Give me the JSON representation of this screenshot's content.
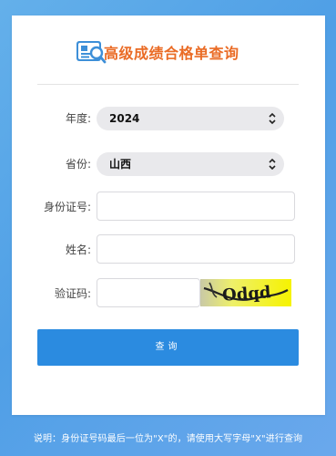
{
  "header": {
    "title": "高级成绩合格单查询",
    "logo_icon": "document-search-icon",
    "title_color": "#ea6b25"
  },
  "form": {
    "year": {
      "label": "年度:",
      "value": "2024"
    },
    "province": {
      "label": "省份:",
      "value": "山西"
    },
    "id_number": {
      "label": "身份证号:",
      "value": "",
      "placeholder": ""
    },
    "name": {
      "label": "姓名:",
      "value": "",
      "placeholder": ""
    },
    "captcha": {
      "label": "验证码:",
      "value": "",
      "placeholder": "",
      "image_text": "Odqd"
    }
  },
  "submit_label": "查询",
  "note": "说明：身份证号码最后一位为\"X\"的，请使用大写字母\"X\"进行查询",
  "colors": {
    "accent": "#2b8be0",
    "background": "#5ba6e9",
    "select_bg": "#e9e9ec"
  }
}
